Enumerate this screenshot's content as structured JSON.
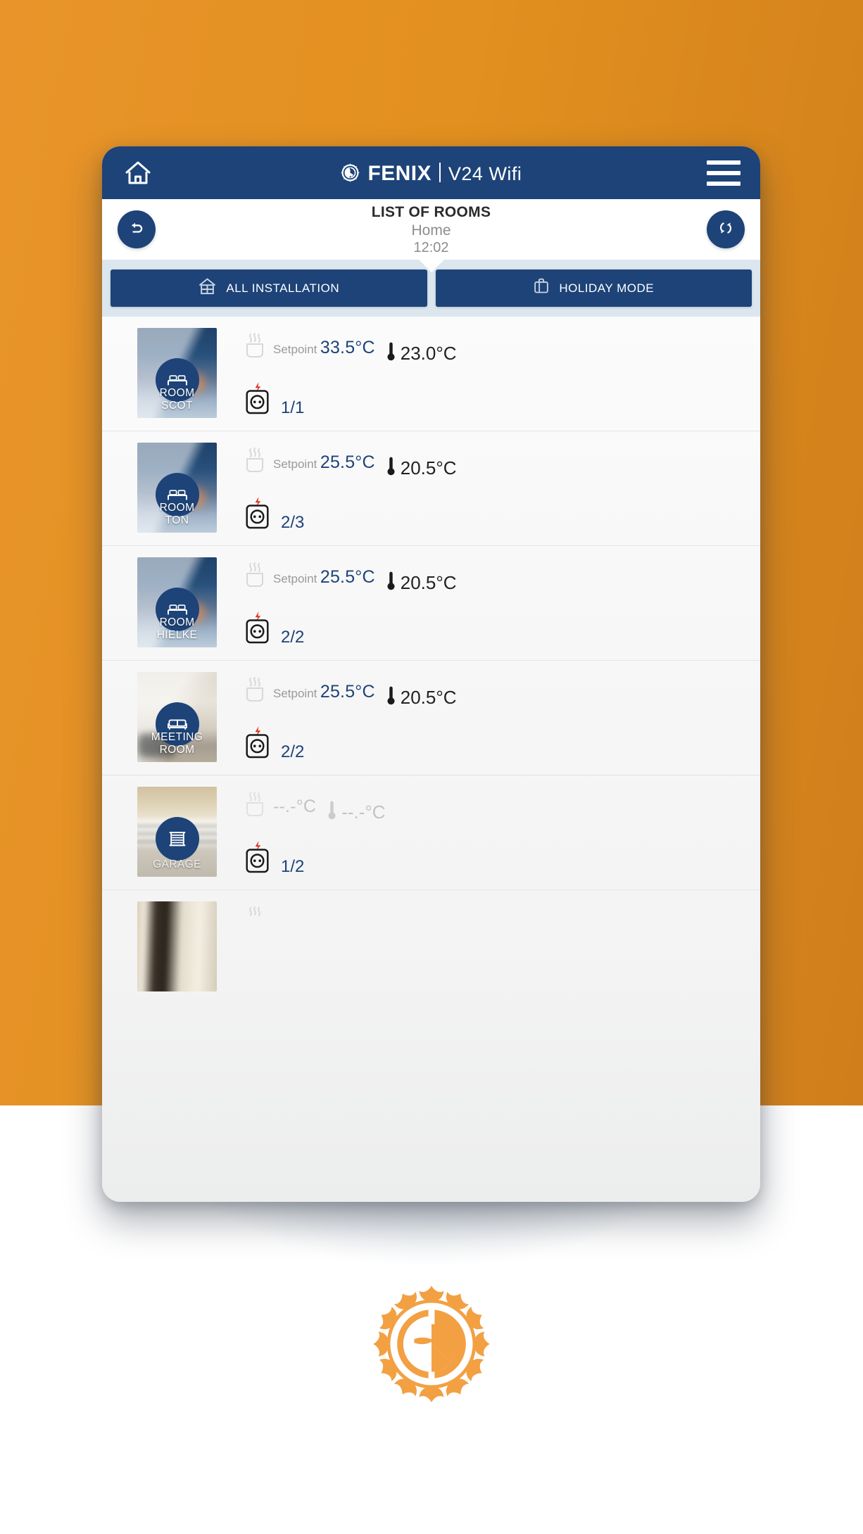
{
  "colors": {
    "background_orange": "#e2901f",
    "brand_navy": "#1d4378",
    "brand_orange": "#f3a043",
    "tabstrip_bg": "#dbe6ef",
    "muted_grey": "#9a9a9a",
    "disabled_grey": "#c3c3c3",
    "spark_red": "#e03423"
  },
  "appbar": {
    "home_icon": "home-icon",
    "brand_mark_icon": "fenix-sun-icon",
    "brand_name": "FENIX",
    "brand_model": "V24  Wifi",
    "menu_icon": "hamburger-menu-icon"
  },
  "subheader": {
    "back_icon": "back-arrow-icon",
    "refresh_icon": "refresh-icon",
    "title": "LIST OF ROOMS",
    "subtitle": "Home",
    "time": "12:02"
  },
  "tabs": [
    {
      "label": "ALL INSTALLATION",
      "icon": "house-outline-icon"
    },
    {
      "label": "HOLIDAY MODE",
      "icon": "suitcase-icon"
    }
  ],
  "labels": {
    "setpoint": "Setpoint"
  },
  "rooms": [
    {
      "name_line1": "ROOM",
      "name_line2": "SCOT",
      "icon": "bed-icon",
      "photo": "photo-bedroom",
      "setpoint_label": "Setpoint",
      "setpoint": "33.5°C",
      "ambient": "23.0°C",
      "power": "1/1",
      "disabled": false
    },
    {
      "name_line1": "ROOM",
      "name_line2": "TON",
      "icon": "bed-icon",
      "photo": "photo-bedroom",
      "setpoint_label": "Setpoint",
      "setpoint": "25.5°C",
      "ambient": "20.5°C",
      "power": "2/3",
      "disabled": false
    },
    {
      "name_line1": "ROOM",
      "name_line2": "HIELKE",
      "icon": "bed-icon",
      "photo": "photo-bedroom",
      "setpoint_label": "Setpoint",
      "setpoint": "25.5°C",
      "ambient": "20.5°C",
      "power": "2/2",
      "disabled": false
    },
    {
      "name_line1": "MEETING",
      "name_line2": "ROOM",
      "icon": "sofa-icon",
      "photo": "photo-living",
      "setpoint_label": "Setpoint",
      "setpoint": "25.5°C",
      "ambient": "20.5°C",
      "power": "2/2",
      "disabled": false
    },
    {
      "name_line1": "GARAGE",
      "name_line2": "",
      "icon": "garage-door-icon",
      "photo": "photo-garage",
      "setpoint_label": "",
      "setpoint": "--.-°C",
      "ambient": "--.-°C",
      "power": "1/2",
      "disabled": true
    }
  ],
  "footer": {
    "logo_icon": "fenix-sun-logo"
  }
}
